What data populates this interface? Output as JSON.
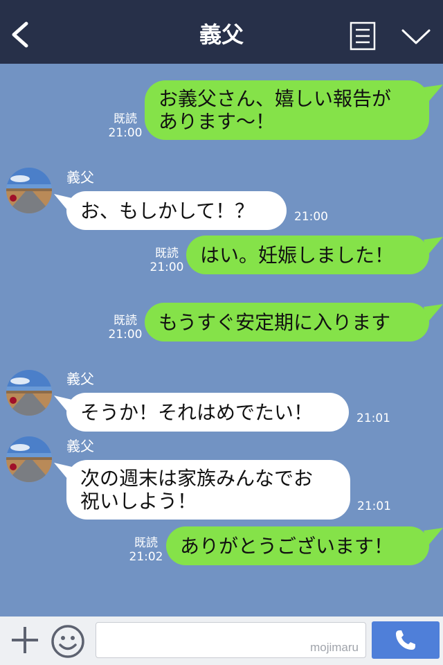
{
  "header": {
    "title": "義父",
    "back_icon": "chevron-left-icon",
    "menu_icon": "list-menu-icon",
    "expand_icon": "chevron-down-icon",
    "background": "#273049"
  },
  "chat": {
    "background": "#7293c3",
    "outgoing_color": "#85e249",
    "incoming_color": "#ffffff",
    "messages": [
      {
        "from": "me",
        "lines": [
          "お義父さん、嬉しい報告が",
          "あります〜！"
        ],
        "read": "既読",
        "time": "21:00"
      },
      {
        "from": "義父",
        "sender_name": "義父",
        "lines": [
          "お、もしかして！？"
        ],
        "time": "21:00"
      },
      {
        "from": "me",
        "lines": [
          "はい。妊娠しました！"
        ],
        "read": "既読",
        "time": "21:00"
      },
      {
        "from": "me",
        "lines": [
          "もうすぐ安定期に入ります"
        ],
        "read": "既読",
        "time": "21:00"
      },
      {
        "from": "義父",
        "sender_name": "義父",
        "lines": [
          "そうか！それはめでたい！"
        ],
        "time": "21:01"
      },
      {
        "from": "義父",
        "sender_name": "義父",
        "lines": [
          "次の週末は家族みんなでお",
          "祝いしよう！"
        ],
        "time": "21:01"
      },
      {
        "from": "me",
        "lines": [
          "ありがとうございます！"
        ],
        "read": "既読",
        "time": "21:02"
      }
    ]
  },
  "input_bar": {
    "plus_icon": "plus-icon",
    "emoji_icon": "smiley-icon",
    "watermark": "mojimaru",
    "call_icon": "phone-icon",
    "call_color": "#4f7fd9"
  }
}
